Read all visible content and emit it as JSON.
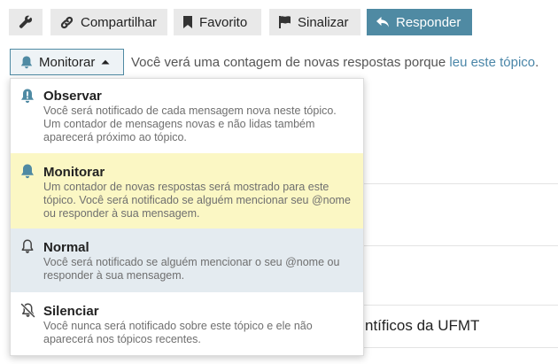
{
  "toolbar": {
    "share_label": "Compartilhar",
    "bookmark_label": "Favorito",
    "flag_label": "Sinalizar",
    "reply_label": "Responder"
  },
  "notifications": {
    "current_label": "Monitorar",
    "reason_text": "Você verá uma contagem de novas respostas porque ",
    "reason_link": "leu este tópico",
    "reason_end": "."
  },
  "dropdown": {
    "options": [
      {
        "title": "Observar",
        "icon": "bell-alert-icon",
        "desc": "Você será notificado de cada mensagem nova neste tópico. Um contador de mensagens novas e não lidas também aparecerá próximo ao tópico."
      },
      {
        "title": "Monitorar",
        "icon": "bell-icon",
        "desc": "Um contador de novas respostas será mostrado para este tópico. Você será notificado se alguém mencionar seu @nome ou responder à sua mensagem."
      },
      {
        "title": "Normal",
        "icon": "bell-outline-icon",
        "desc": "Você será notificado se alguém mencionar o seu @nome ou responder à sua mensagem."
      },
      {
        "title": "Silenciar",
        "icon": "bell-slash-icon",
        "desc": "Você nunca será notificado sobre este tópico e ele não aparecerá nos tópicos recentes."
      }
    ]
  },
  "background": {
    "partial_text": "ntíficos da UFMT"
  },
  "colors": {
    "primary": "#4f8aa3",
    "selected_bg": "#fbf7c4",
    "hover_bg": "#e4ebf0",
    "link": "#4a86a8"
  }
}
